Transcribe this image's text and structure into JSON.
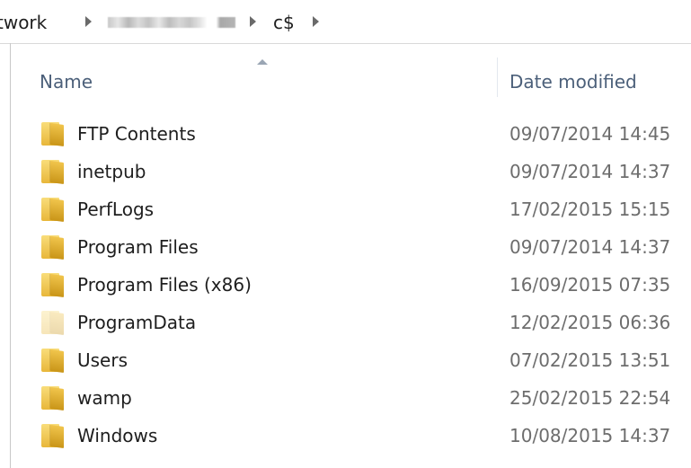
{
  "address_bar": {
    "network_crumb": "twork",
    "share_crumb": "c$"
  },
  "columns": {
    "name": "Name",
    "date_modified": "Date modified"
  },
  "files": [
    {
      "name": "FTP Contents",
      "date": "09/07/2014 14:45",
      "icon": "folder-icon"
    },
    {
      "name": "inetpub",
      "date": "09/07/2014 14:37",
      "icon": "folder-icon"
    },
    {
      "name": "PerfLogs",
      "date": "17/02/2015 15:15",
      "icon": "folder-icon"
    },
    {
      "name": "Program Files",
      "date": "09/07/2014 14:37",
      "icon": "folder-icon"
    },
    {
      "name": "Program Files (x86)",
      "date": "16/09/2015 07:35",
      "icon": "folder-icon"
    },
    {
      "name": "ProgramData",
      "date": "12/02/2015 06:36",
      "icon": "hidden-folder-icon"
    },
    {
      "name": "Users",
      "date": "07/02/2015 13:51",
      "icon": "folder-icon"
    },
    {
      "name": "wamp",
      "date": "25/02/2015 22:54",
      "icon": "folder-icon"
    },
    {
      "name": "Windows",
      "date": "10/08/2015 14:37",
      "icon": "folder-icon"
    }
  ],
  "colors": {
    "header_text": "#4c607a",
    "folder": "#e8b73a"
  }
}
